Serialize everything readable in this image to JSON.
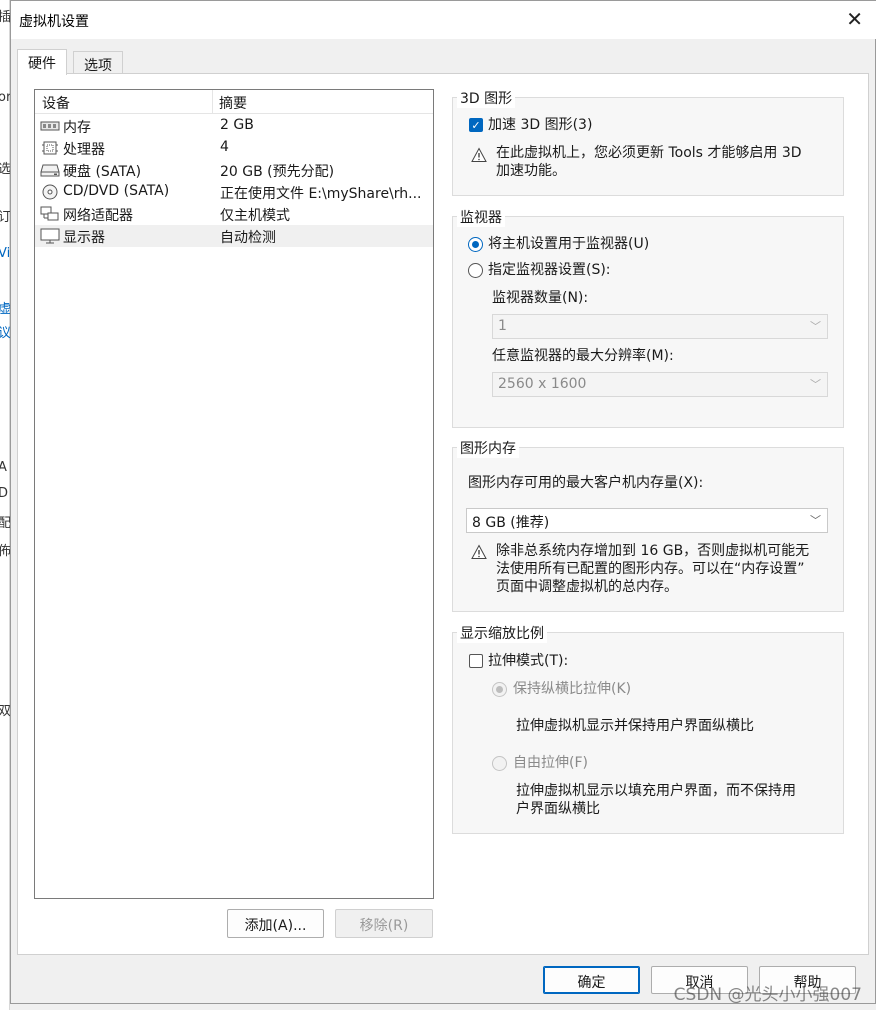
{
  "window": {
    "title": "虚拟机设置"
  },
  "tabs": [
    {
      "label": "硬件",
      "active": true
    },
    {
      "label": "选项",
      "active": false
    }
  ],
  "device_list": {
    "headers": [
      "设备",
      "摘要"
    ],
    "rows": [
      {
        "icon": "memory-icon",
        "name": "内存",
        "summary": "2 GB"
      },
      {
        "icon": "processor-icon",
        "name": "处理器",
        "summary": "4"
      },
      {
        "icon": "hard-disk-icon",
        "name": "硬盘 (SATA)",
        "summary": "20 GB (预先分配)"
      },
      {
        "icon": "cd-dvd-icon",
        "name": "CD/DVD (SATA)",
        "summary": "正在使用文件 E:\\myShare\\rh..."
      },
      {
        "icon": "network-adapter-icon",
        "name": "网络适配器",
        "summary": "仅主机模式"
      },
      {
        "icon": "display-icon",
        "name": "显示器",
        "summary": "自动检测",
        "selected": true
      }
    ],
    "add_button": "添加(A)...",
    "remove_button": "移除(R)"
  },
  "graphics_3d": {
    "legend": "3D 图形",
    "accelerate_label": "加速 3D 图形(3)",
    "accelerate_checked": true,
    "warning": "在此虚拟机上，您必须更新 Tools 才能够启用 3D 加速功能。",
    "warning_line1": "在此虚拟机上，您必须更新 Tools 才能够启用 3D",
    "warning_line2": "加速功能。"
  },
  "monitor": {
    "legend": "监视器",
    "use_host_label": "将主机设置用于监视器(U)",
    "specify_label": "指定监视器设置(S):",
    "selected": "use_host",
    "count_label": "监视器数量(N):",
    "count_value": "1",
    "max_res_label": "任意监视器的最大分辨率(M):",
    "max_res_value": "2560 x 1600"
  },
  "graphics_memory": {
    "legend": "图形内存",
    "max_label": "图形内存可用的最大客户机内存量(X):",
    "value": "8 GB (推荐)",
    "warning_line1": "除非总系统内存增加到 16 GB，否则虚拟机可能无",
    "warning_line2": "法使用所有已配置的图形内存。可以在“内存设置”",
    "warning_line3": "页面中调整虚拟机的总内存。"
  },
  "display_scaling": {
    "legend": "显示缩放比例",
    "stretch_label": "拉伸模式(T):",
    "stretch_checked": false,
    "keep_aspect_label": "保持纵横比拉伸(K)",
    "keep_aspect_desc": "拉伸虚拟机显示并保持用户界面纵横比",
    "free_label": "自由拉伸(F)",
    "free_desc_line1": "拉伸虚拟机显示以填充用户界面，而不保持用",
    "free_desc_line2": "户界面纵横比"
  },
  "footer": {
    "ok": "确定",
    "cancel": "取消",
    "help": "帮助"
  },
  "watermark": "CSDN @光头小小强007",
  "background_fragments": [
    "插",
    "or",
    "选",
    "订",
    "Vi",
    "虚",
    "议",
    "A",
    "D",
    "配",
    "佈",
    "双"
  ],
  "colors": {
    "accent": "#0067c0",
    "selected_row": "#f0f0f0"
  }
}
